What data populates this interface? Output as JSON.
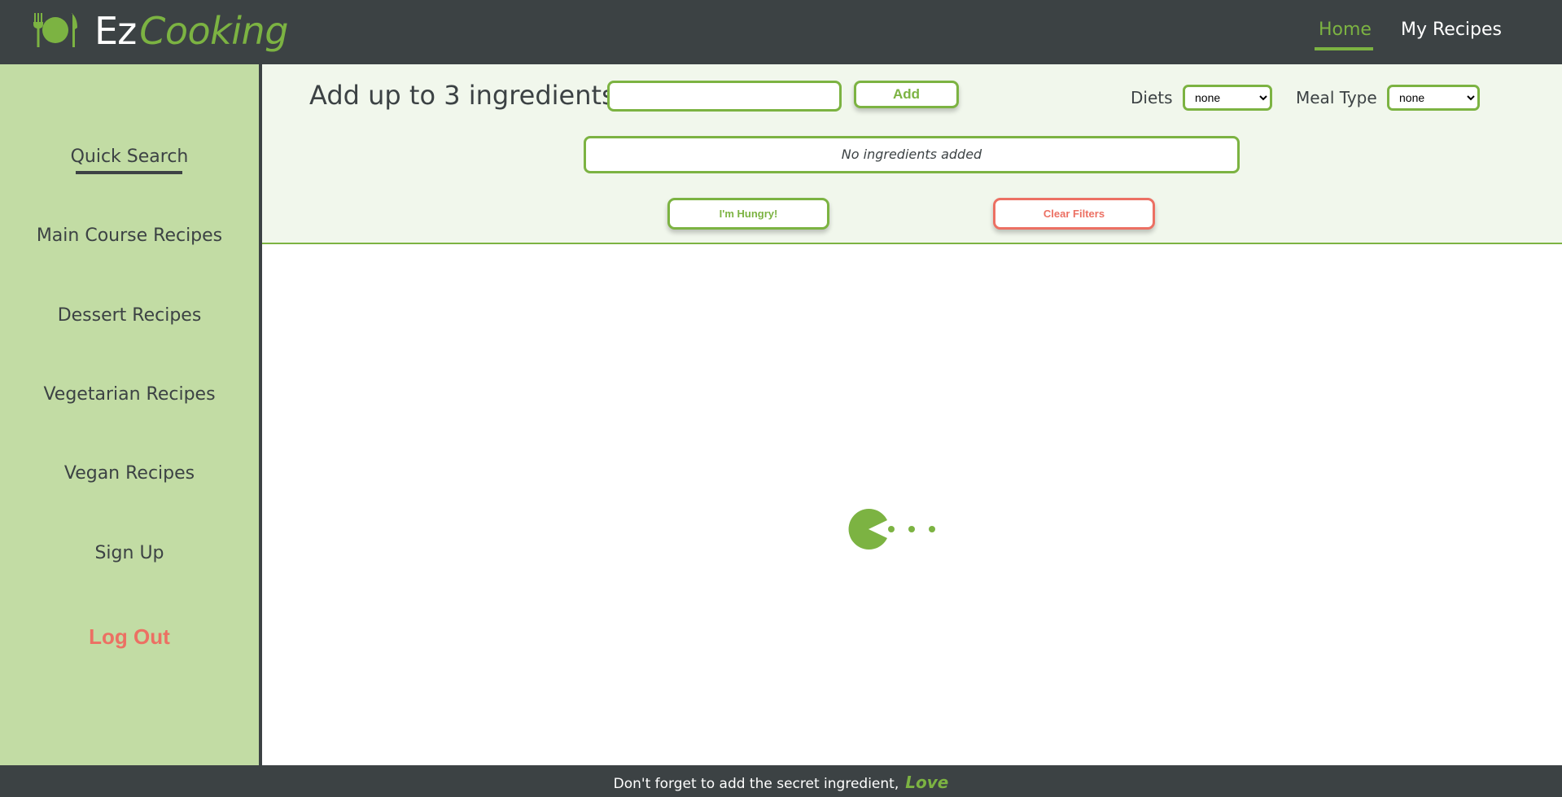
{
  "header": {
    "brand_ez": "Ez",
    "brand_cooking": "Cooking",
    "nav": {
      "home": "Home",
      "my_recipes": "My Recipes"
    }
  },
  "sidebar": {
    "items": [
      {
        "label": "Quick Search"
      },
      {
        "label": "Main Course Recipes"
      },
      {
        "label": "Dessert Recipes"
      },
      {
        "label": "Vegetarian Recipes"
      },
      {
        "label": "Vegan Recipes"
      },
      {
        "label": "Sign Up"
      },
      {
        "label": "Log Out"
      }
    ]
  },
  "filters": {
    "title": "Add up to 3 ingredients!",
    "ingredient_value": "",
    "add_label": "Add",
    "diets_label": "Diets",
    "diets_selected": "none",
    "meal_type_label": "Meal Type",
    "meal_type_selected": "none",
    "ingredients_empty": "No ingredients added",
    "hungry_label": "I'm Hungry!",
    "clear_label": "Clear Filters"
  },
  "footer": {
    "text": "Don't forget to add the secret ingredient,",
    "love": "Love"
  },
  "colors": {
    "dark": "#3c4244",
    "green": "#7cb342",
    "sidebar_bg": "#c2dca4",
    "panel_bg": "#f1f7ec",
    "red": "#ec7063"
  },
  "icons": {
    "logo": "fork-plate-knife-icon",
    "loader": "pacman-loader-icon"
  }
}
